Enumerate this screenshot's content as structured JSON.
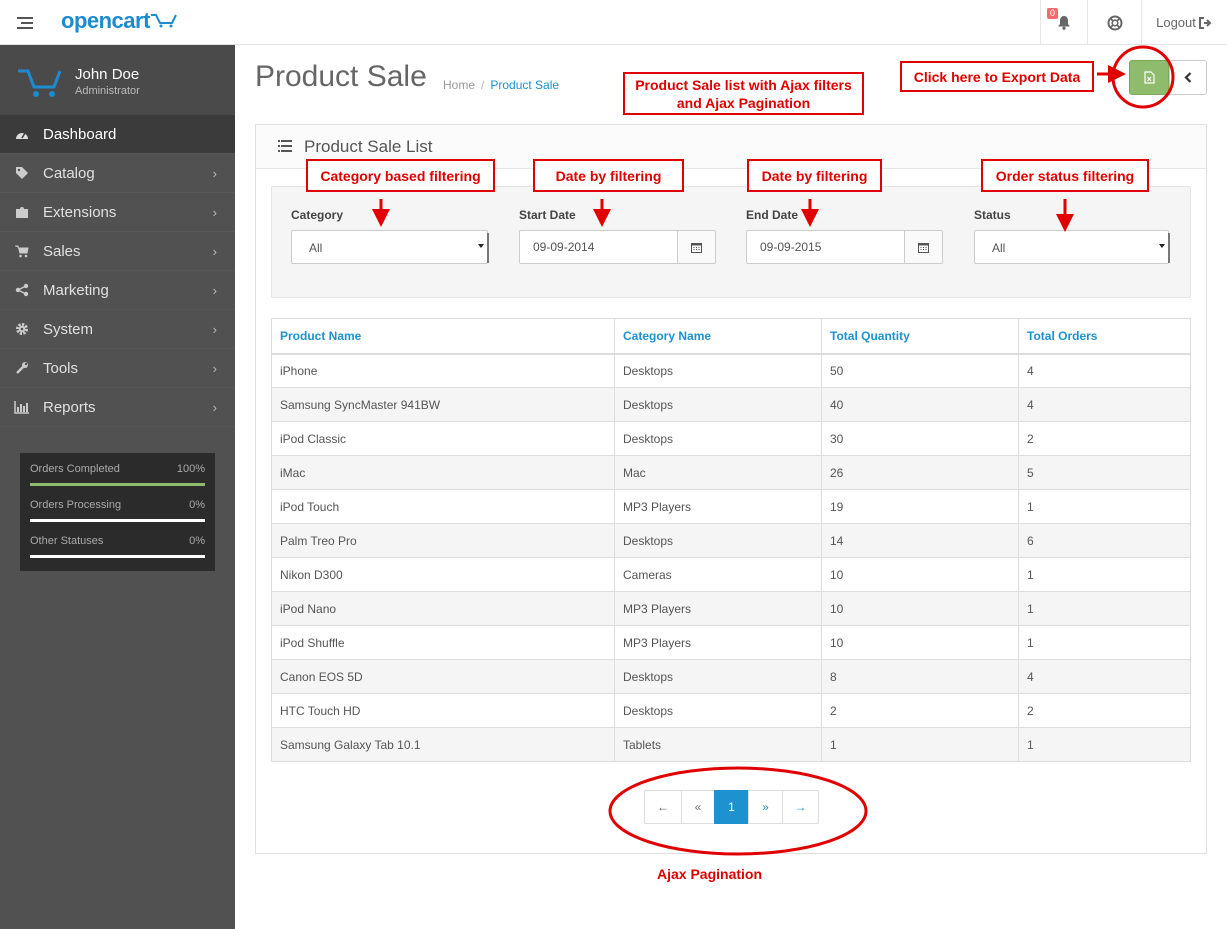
{
  "header": {
    "logo": "opencart",
    "notification_count": "0",
    "logout_label": "Logout"
  },
  "sidebar": {
    "user_name": "John Doe",
    "user_role": "Administrator",
    "items": [
      {
        "label": "Dashboard",
        "icon": "dashboard-icon"
      },
      {
        "label": "Catalog",
        "icon": "tags-icon"
      },
      {
        "label": "Extensions",
        "icon": "puzzle-icon"
      },
      {
        "label": "Sales",
        "icon": "cart-icon"
      },
      {
        "label": "Marketing",
        "icon": "share-icon"
      },
      {
        "label": "System",
        "icon": "cog-icon"
      },
      {
        "label": "Tools",
        "icon": "wrench-icon"
      },
      {
        "label": "Reports",
        "icon": "bar-chart-icon"
      }
    ],
    "stats": [
      {
        "label": "Orders Completed",
        "value": "100%",
        "fraction": 1.0
      },
      {
        "label": "Orders Processing",
        "value": "0%",
        "fraction": 0
      },
      {
        "label": "Other Statuses",
        "value": "0%",
        "fraction": 0
      }
    ]
  },
  "page": {
    "title": "Product Sale",
    "breadcrumb_home": "Home",
    "breadcrumb_sep": "/",
    "breadcrumb_current": "Product Sale",
    "panel_title": "Product Sale List"
  },
  "filters": {
    "category_label": "Category",
    "category_value": "All",
    "start_label": "Start Date",
    "start_value": "09-09-2014",
    "end_label": "End Date",
    "end_value": "09-09-2015",
    "status_label": "Status",
    "status_value": "All"
  },
  "table": {
    "headers": [
      "Product Name",
      "Category Name",
      "Total Quantity",
      "Total Orders"
    ],
    "rows": [
      [
        "iPhone",
        "Desktops",
        "50",
        "4"
      ],
      [
        "Samsung SyncMaster 941BW",
        "Desktops",
        "40",
        "4"
      ],
      [
        "iPod Classic",
        "Desktops",
        "30",
        "2"
      ],
      [
        "iMac",
        "Mac",
        "26",
        "5"
      ],
      [
        "iPod Touch",
        "MP3 Players",
        "19",
        "1"
      ],
      [
        "Palm Treo Pro",
        "Desktops",
        "14",
        "6"
      ],
      [
        "Nikon D300",
        "Cameras",
        "10",
        "1"
      ],
      [
        "iPod Nano",
        "MP3 Players",
        "10",
        "1"
      ],
      [
        "iPod Shuffle",
        "MP3 Players",
        "10",
        "1"
      ],
      [
        "Canon EOS 5D",
        "Desktops",
        "8",
        "4"
      ],
      [
        "HTC Touch HD",
        "Desktops",
        "2",
        "2"
      ],
      [
        "Samsung Galaxy Tab 10.1",
        "Tablets",
        "1",
        "1"
      ]
    ]
  },
  "pagination": {
    "first": "←",
    "prev": "«",
    "current": "1",
    "next": "»",
    "last": "→"
  },
  "annotations": {
    "export": "Click here to Export Data",
    "list_line1": "Product Sale list with Ajax filters",
    "list_line2": "and Ajax Pagination",
    "category": "Category based filtering",
    "start_date": "Date by filtering",
    "end_date": "Date by filtering",
    "status": "Order status filtering",
    "pagination": "Ajax Pagination"
  },
  "colors": {
    "accent": "#1e91cf",
    "sidebar": "#515151",
    "export_button": "#8fbb6c",
    "annotation": "#e00000"
  }
}
